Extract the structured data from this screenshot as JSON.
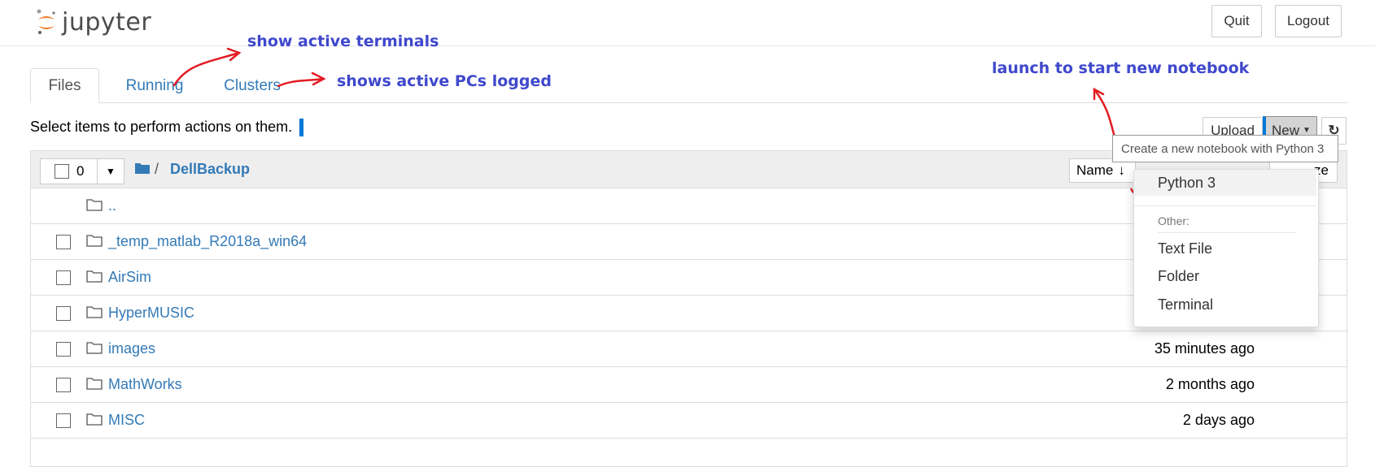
{
  "header": {
    "logo_text": "jupyter",
    "quit_label": "Quit",
    "logout_label": "Logout"
  },
  "tabs": [
    {
      "label": "Files"
    },
    {
      "label": "Running"
    },
    {
      "label": "Clusters"
    }
  ],
  "annotations": {
    "terminals": "show active terminals",
    "clusters": "shows active PCs logged",
    "new_notebook": "launch to start new notebook",
    "color": "#3f48cc",
    "arrow_color": "#e31c23"
  },
  "toolbar": {
    "select_text": "Select items to perform actions on them.",
    "upload_label": "Upload",
    "new_label": "New",
    "refresh_icon": "refresh-icon"
  },
  "list": {
    "selected_count": "0",
    "breadcrumb_sep": "/",
    "breadcrumb_folder": "DellBackup",
    "sort_name_label": "Name",
    "sort_hidden_fragment": "ze",
    "parent_label": "..",
    "rows": [
      {
        "name": "_temp_matlab_R2018a_win64",
        "time": ""
      },
      {
        "name": "AirSim",
        "time": ""
      },
      {
        "name": "HyperMUSIC",
        "time": ""
      },
      {
        "name": "images",
        "time": "35 minutes ago"
      },
      {
        "name": "MathWorks",
        "time": "2 months ago"
      },
      {
        "name": "MISC",
        "time": "2 days ago"
      }
    ],
    "accent": "#337ab7"
  },
  "new_menu": {
    "tooltip": "Create a new notebook with Python 3",
    "python3": "Python 3",
    "other_header": "Other:",
    "items": [
      "Text File",
      "Folder",
      "Terminal"
    ]
  }
}
